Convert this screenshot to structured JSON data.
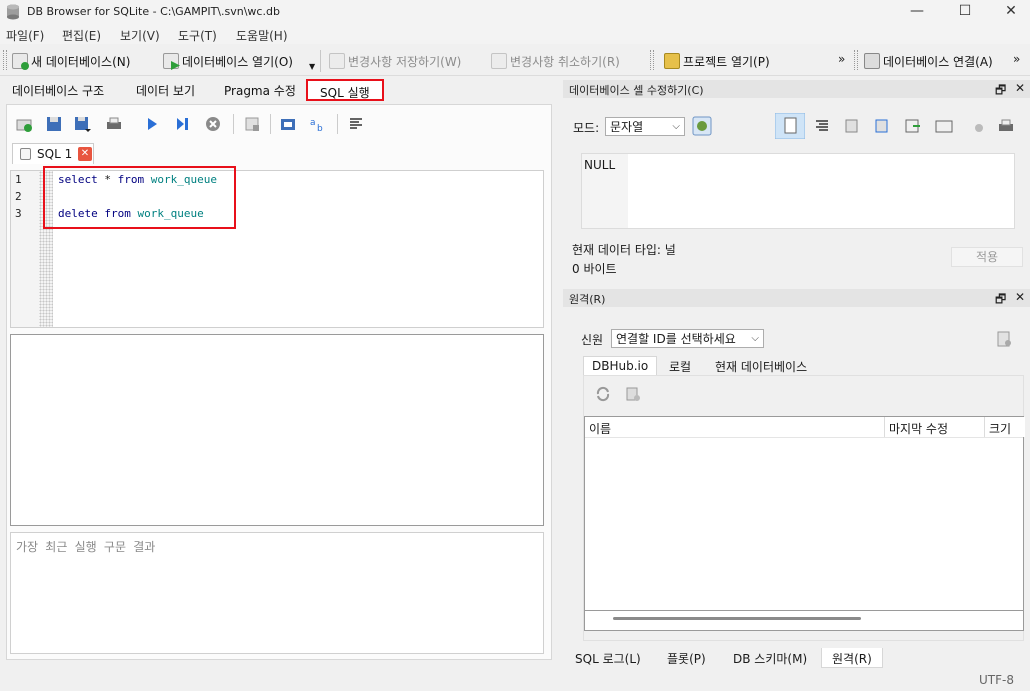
{
  "window": {
    "title": "DB Browser for SQLite - C:\\GAMPIT\\.svn\\wc.db",
    "minimize": "—",
    "maximize": "☐",
    "close": "✕"
  },
  "menu": [
    "파일(F)",
    "편집(E)",
    "보기(V)",
    "도구(T)",
    "도움말(H)"
  ],
  "toolbar": {
    "new_db": "새 데이터베이스(N)",
    "open_db": "데이터베이스 열기(O)",
    "write_changes": "변경사항 저장하기(W)",
    "revert_changes": "변경사항 취소하기(R)",
    "open_project": "프로젝트 열기(P)",
    "attach_db": "데이터베이스 연결(A)",
    "overflow": "»"
  },
  "main_tabs": [
    "데이터베이스 구조",
    "데이터 보기",
    "Pragma 수정",
    "SQL 실행"
  ],
  "sql_editor": {
    "tab_label": "SQL 1",
    "lines": [
      {
        "num": "1",
        "kw1": "select",
        "mid": " * ",
        "kw2": "from",
        "ident": " work_queue"
      },
      {
        "num": "2"
      },
      {
        "num": "3",
        "kw1": "delete",
        "kw2": " from",
        "ident": " work_queue"
      }
    ],
    "message_placeholder": "가장 최근 실행 구문 결과"
  },
  "edit_cell": {
    "title": "데이터베이스 셀 수정하기(C)",
    "mode_label": "모드:",
    "mode_value": "문자열",
    "null_label": "NULL",
    "type_label": "현재 데이터 타입: 널",
    "size_label": "0 바이트",
    "apply": "적용"
  },
  "remote": {
    "title": "원격(R)",
    "identity_label": "신원",
    "identity_value": "연결할 ID를 선택하세요",
    "tabs": [
      "DBHub.io",
      "로컬",
      "현재 데이터베이스"
    ],
    "columns": [
      "이름",
      "마지막 수정",
      "크기"
    ]
  },
  "dock_controls": {
    "float": "🗗",
    "close": "✕"
  },
  "bottom_tabs": [
    "SQL 로그(L)",
    "플롯(P)",
    "DB 스키마(M)",
    "원격(R)"
  ],
  "status": {
    "encoding": "UTF-8"
  },
  "colors": {
    "highlight": "#e8101a",
    "keyword": "#000080",
    "identifier": "#008080"
  }
}
